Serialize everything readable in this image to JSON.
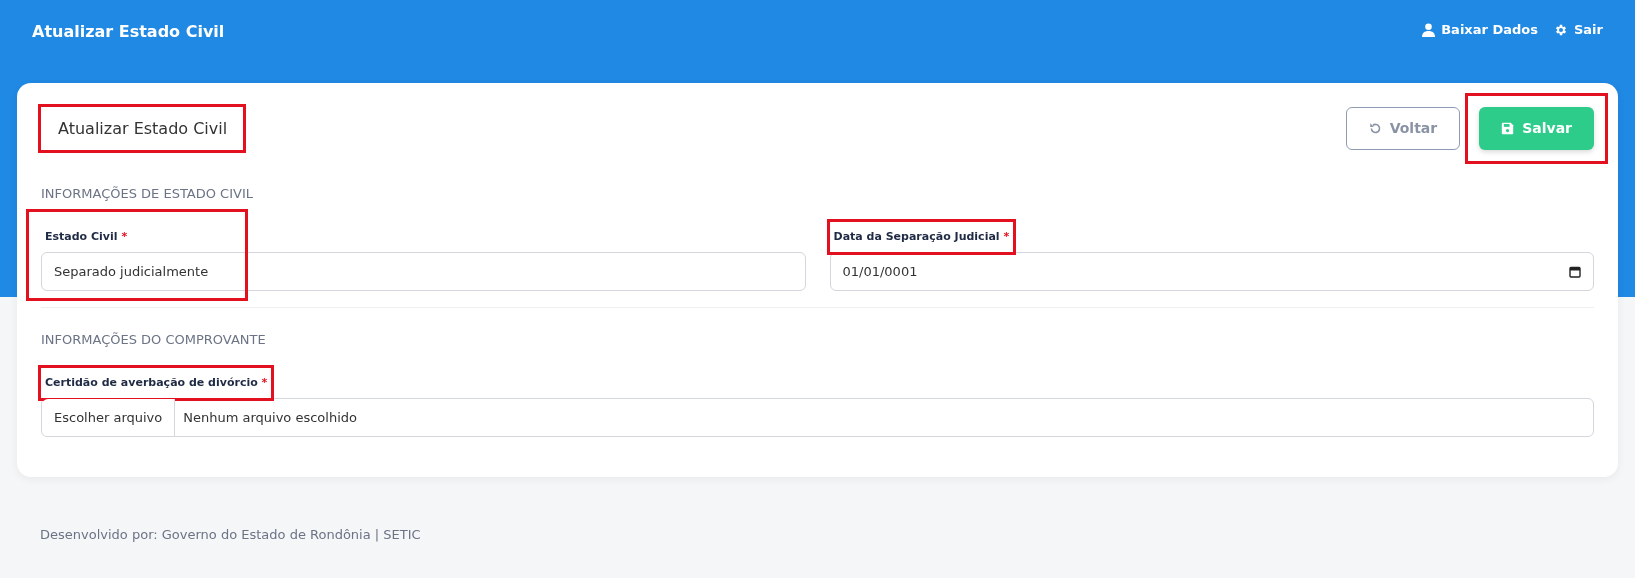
{
  "navbar": {
    "title": "Atualizar Estado Civil",
    "links": [
      {
        "kind": "user",
        "label": "Baixar Dados"
      },
      {
        "kind": "gear",
        "label": "Sair"
      }
    ]
  },
  "card": {
    "title": "Atualizar Estado Civil",
    "title_highlighted": true,
    "buttons": [
      {
        "kind": "back",
        "label": "Voltar",
        "highlighted": false
      },
      {
        "kind": "save",
        "label": "Salvar",
        "highlighted": true
      }
    ],
    "sections": [
      {
        "heading": "INFORMAÇÕES DE ESTADO CIVIL",
        "fields": [
          {
            "kind": "select",
            "label": "Estado Civil",
            "required_mark": "*",
            "value": "Separado judicialmente",
            "label_highlighted": true,
            "input_highlighted": true
          },
          {
            "kind": "date",
            "label": "Data da Separação Judicial",
            "required_mark": "*",
            "value": "01/01/0001",
            "label_highlighted": true
          }
        ]
      },
      {
        "heading": "INFORMAÇÕES DO COMPROVANTE",
        "fields": [
          {
            "kind": "file",
            "label": "Certidão de averbação de divórcio",
            "required_mark": "*",
            "button": "Escolher arquivo",
            "value": "Nenhum arquivo escolhido",
            "label_highlighted": true
          }
        ]
      }
    ]
  },
  "footer": "Desenvolvido por: Governo do Estado de Rondônia | SETIC"
}
